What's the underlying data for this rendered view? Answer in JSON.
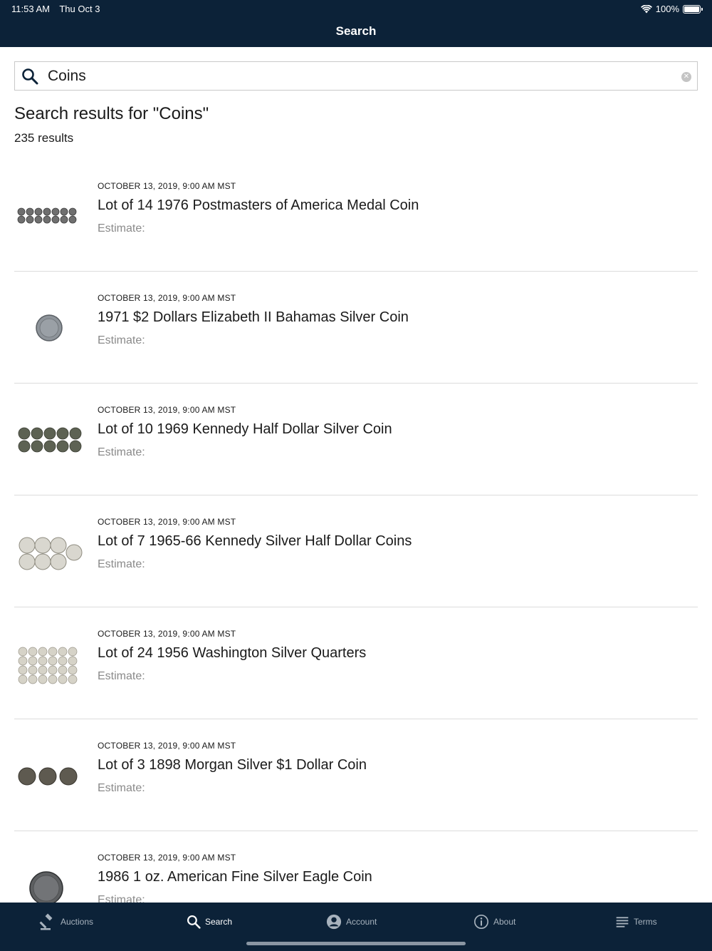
{
  "status_bar": {
    "time": "11:53 AM",
    "date": "Thu Oct 3",
    "battery": "100%"
  },
  "nav": {
    "title": "Search"
  },
  "search": {
    "value": "Coins",
    "placeholder": ""
  },
  "results": {
    "heading": "Search results for \"Coins\"",
    "count": "235 results",
    "items": [
      {
        "date": "OCTOBER 13, 2019, 9:00 AM MST",
        "title": "Lot of 14 1976 Postmasters of America Medal Coin",
        "estimate": "Estimate:"
      },
      {
        "date": "OCTOBER 13, 2019, 9:00 AM MST",
        "title": "1971 $2 Dollars Elizabeth II Bahamas Silver Coin",
        "estimate": "Estimate:"
      },
      {
        "date": "OCTOBER 13, 2019, 9:00 AM MST",
        "title": "Lot of 10 1969 Kennedy Half Dollar Silver Coin",
        "estimate": "Estimate:"
      },
      {
        "date": "OCTOBER 13, 2019, 9:00 AM MST",
        "title": "Lot of 7 1965-66 Kennedy Silver Half Dollar Coins",
        "estimate": "Estimate:"
      },
      {
        "date": "OCTOBER 13, 2019, 9:00 AM MST",
        "title": "Lot of 24 1956 Washington Silver Quarters",
        "estimate": "Estimate:"
      },
      {
        "date": "OCTOBER 13, 2019, 9:00 AM MST",
        "title": "Lot of 3 1898 Morgan Silver  $1 Dollar Coin",
        "estimate": "Estimate:"
      },
      {
        "date": "OCTOBER 13, 2019, 9:00 AM MST",
        "title": "1986 1 oz.  American Fine Silver Eagle Coin",
        "estimate": "Estimate:"
      }
    ]
  },
  "tabs": [
    {
      "label": "Auctions",
      "icon": "gavel-icon"
    },
    {
      "label": "Search",
      "icon": "search-icon"
    },
    {
      "label": "Account",
      "icon": "account-icon"
    },
    {
      "label": "About",
      "icon": "info-icon"
    },
    {
      "label": "Terms",
      "icon": "list-icon"
    }
  ],
  "colors": {
    "header_bg": "#0c2238",
    "accent": "#0c2238",
    "muted": "#8a8a8a",
    "divider": "#dcdcdc"
  }
}
